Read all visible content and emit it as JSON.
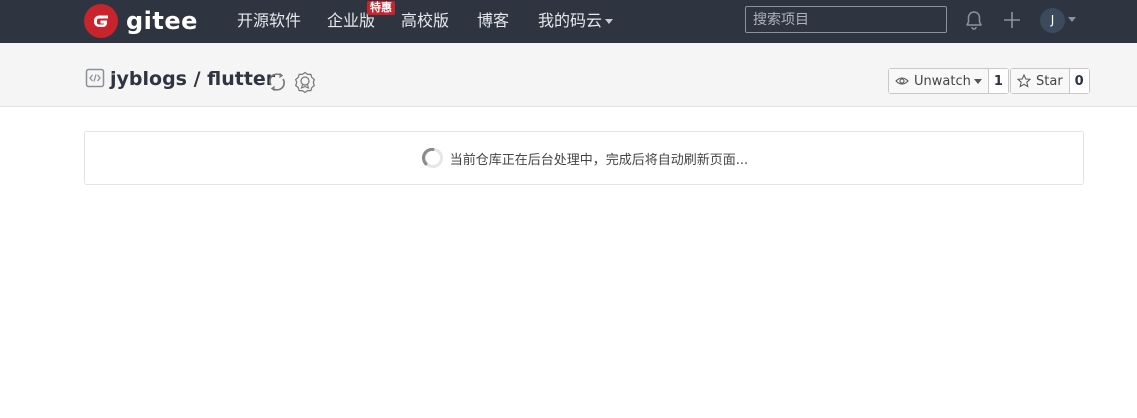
{
  "navbar": {
    "logo_text": "gitee",
    "items": [
      {
        "label": "开源软件"
      },
      {
        "label": "企业版"
      },
      {
        "label": "高校版"
      },
      {
        "label": "博客"
      },
      {
        "label": "我的码云"
      }
    ],
    "badge": "特惠",
    "search_placeholder": "搜索项目",
    "avatar_initial": "J",
    "colors": {
      "background": "#2e3440",
      "logo_red": "#c7242e"
    }
  },
  "repo": {
    "title": "jyblogs / flutter",
    "watch": {
      "label": "Unwatch",
      "count": "1"
    },
    "star": {
      "label": "Star",
      "count": "0"
    }
  },
  "status": {
    "message": "当前仓库正在后台处理中，完成后将自动刷新页面..."
  }
}
